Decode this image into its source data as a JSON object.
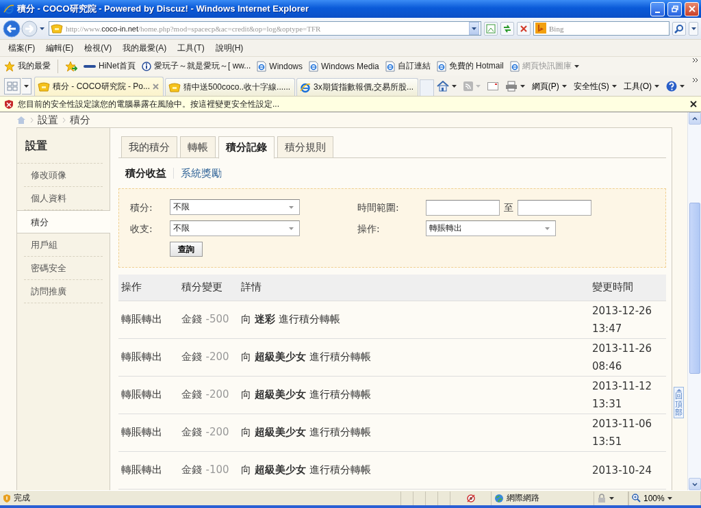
{
  "window": {
    "title": "積分 - COCO研究院 - Powered by Discuz! - Windows Internet Explorer"
  },
  "address_bar": {
    "url_prefix": "http://www.",
    "url_host": "coco-in.net",
    "url_path": "/home.php?mod=spacecp&ac=credit&op=log&optype=TFR",
    "search_placeholder": "Bing"
  },
  "menu": [
    "檔案(F)",
    "編輯(E)",
    "檢視(V)",
    "我的最愛(A)",
    "工具(T)",
    "說明(H)"
  ],
  "favorites_bar": {
    "favorites_label": "我的最愛",
    "links": [
      {
        "label": "HiNet首頁",
        "kind": "hinet",
        "disabled": false
      },
      {
        "label": "愛玩子～就是愛玩～[ ww...",
        "kind": "info",
        "disabled": false
      },
      {
        "label": "Windows",
        "kind": "page",
        "disabled": false
      },
      {
        "label": "Windows Media",
        "kind": "page",
        "disabled": false
      },
      {
        "label": "自訂連結",
        "kind": "page",
        "disabled": false
      },
      {
        "label": "免費的 Hotmail",
        "kind": "page",
        "disabled": false
      },
      {
        "label": "網頁快訊圖庫",
        "kind": "gallery",
        "disabled": true
      }
    ]
  },
  "browser_tabs": [
    {
      "title": "積分 - COCO研究院 - Po...",
      "selected": true,
      "kind": "site"
    },
    {
      "title": "猜中送500coco..收十字線......",
      "selected": false,
      "kind": "site"
    },
    {
      "title": "3x期貨指數報價,交易所股...",
      "selected": false,
      "kind": "ie"
    }
  ],
  "command_bar": [
    "網頁(P)",
    "安全性(S)",
    "工具(O)"
  ],
  "info_bar": {
    "message": "您目前的安全性設定讓您的電腦暴露在風險中。按這裡變更安全性設定..."
  },
  "breadcrumb": [
    "設置",
    "積分"
  ],
  "sidebar": {
    "title": "設置",
    "items": [
      {
        "label": "修改頭像",
        "selected": false
      },
      {
        "label": "個人資料",
        "selected": false
      },
      {
        "label": "積分",
        "selected": true
      },
      {
        "label": "用戶組",
        "selected": false
      },
      {
        "label": "密碼安全",
        "selected": false
      },
      {
        "label": "訪問推廣",
        "selected": false
      }
    ]
  },
  "tabs": [
    {
      "label": "我的積分",
      "selected": false
    },
    {
      "label": "轉帳",
      "selected": false
    },
    {
      "label": "積分記錄",
      "selected": true
    },
    {
      "label": "積分規則",
      "selected": false
    }
  ],
  "subtabs": [
    {
      "label": "積分收益",
      "selected": true
    },
    {
      "label": "系統獎勵",
      "selected": false
    }
  ],
  "filters": {
    "credit_label": "積分:",
    "credit_value": "不限",
    "direction_label": "收支:",
    "direction_value": "不限",
    "time_label": "時間範圍:",
    "time_separator": "至",
    "operation_label": "操作:",
    "operation_value": "轉賬轉出",
    "submit": "查詢"
  },
  "table": {
    "columns": [
      "操作",
      "積分變更",
      "詳情",
      "變更時間"
    ],
    "rows": [
      {
        "operation": "轉賬轉出",
        "credit_type": "金錢",
        "amount": "-500",
        "detail": "向 **迷彩** 進行積分轉帳",
        "time": "2013-12-26 13:47"
      },
      {
        "operation": "轉賬轉出",
        "credit_type": "金錢",
        "amount": "-200",
        "detail": "向 **超級美少女** 進行積分轉帳",
        "time": "2013-11-26 08:46"
      },
      {
        "operation": "轉賬轉出",
        "credit_type": "金錢",
        "amount": "-200",
        "detail": "向 **超級美少女** 進行積分轉帳",
        "time": "2013-11-12 13:31"
      },
      {
        "operation": "轉賬轉出",
        "credit_type": "金錢",
        "amount": "-200",
        "detail": "向 **超級美少女** 進行積分轉帳",
        "time": "2013-11-06 13:51"
      },
      {
        "operation": "轉賬轉出",
        "credit_type": "金錢",
        "amount": "-100",
        "detail": "向 **超級美少女** 進行積分轉帳",
        "time": "2013-10-24"
      }
    ]
  },
  "back_to_top": "回頂部",
  "status_bar": {
    "status": "完成",
    "zone": "網際網路",
    "zoom": "100%"
  }
}
